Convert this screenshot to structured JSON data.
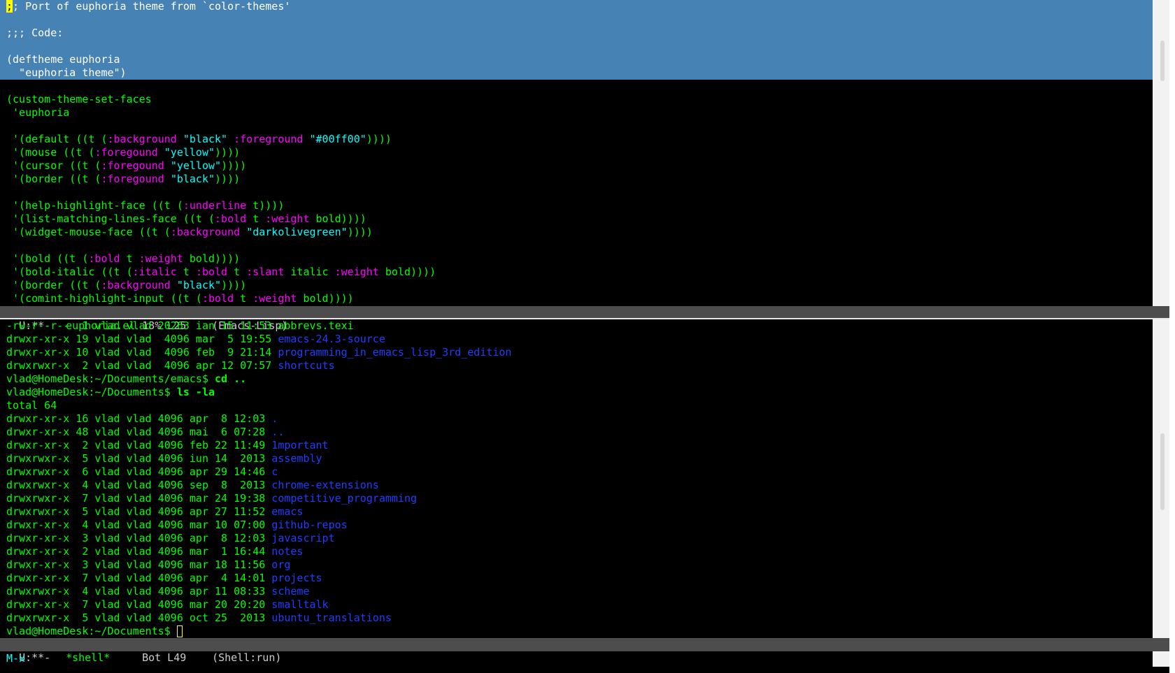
{
  "editor": {
    "lines": [
      {
        "hl": true,
        "segs": [
          {
            "t": ";",
            "c": "cursor-fill"
          },
          {
            "t": "; Port of euphoria theme from `color-themes'"
          }
        ]
      },
      {
        "hl": true,
        "segs": [
          {
            "t": ""
          }
        ]
      },
      {
        "hl": true,
        "segs": [
          {
            "t": ";;; Code:"
          }
        ]
      },
      {
        "hl": true,
        "segs": [
          {
            "t": ""
          }
        ]
      },
      {
        "hl": true,
        "segs": [
          {
            "t": "(deftheme euphoria"
          }
        ]
      },
      {
        "hl": true,
        "segs": [
          {
            "t": "  \"euphoria theme\")"
          }
        ]
      },
      {
        "segs": [
          {
            "t": ""
          }
        ]
      },
      {
        "segs": [
          {
            "t": "(custom-theme-set-faces"
          }
        ]
      },
      {
        "segs": [
          {
            "t": " 'euphoria"
          }
        ]
      },
      {
        "segs": [
          {
            "t": ""
          }
        ]
      },
      {
        "segs": [
          {
            "t": " '(default ((t ("
          },
          {
            "t": ":background",
            "c": "kw"
          },
          {
            "t": " "
          },
          {
            "t": "\"black\"",
            "c": "str"
          },
          {
            "t": " "
          },
          {
            "t": ":foreground",
            "c": "kw"
          },
          {
            "t": " "
          },
          {
            "t": "\"#00ff00\"",
            "c": "str"
          },
          {
            "t": "))))"
          }
        ]
      },
      {
        "segs": [
          {
            "t": " '(mouse ((t ("
          },
          {
            "t": ":foregound",
            "c": "kw"
          },
          {
            "t": " "
          },
          {
            "t": "\"yellow\"",
            "c": "str"
          },
          {
            "t": "))))"
          }
        ]
      },
      {
        "segs": [
          {
            "t": " '(cursor ((t ("
          },
          {
            "t": ":foregound",
            "c": "kw"
          },
          {
            "t": " "
          },
          {
            "t": "\"yellow\"",
            "c": "str"
          },
          {
            "t": "))))"
          }
        ]
      },
      {
        "segs": [
          {
            "t": " '(border ((t ("
          },
          {
            "t": ":foregound",
            "c": "kw"
          },
          {
            "t": " "
          },
          {
            "t": "\"black\"",
            "c": "str"
          },
          {
            "t": "))))"
          }
        ]
      },
      {
        "segs": [
          {
            "t": ""
          }
        ]
      },
      {
        "segs": [
          {
            "t": " '(help-highlight-face ((t ("
          },
          {
            "t": ":underline",
            "c": "kw"
          },
          {
            "t": " t))))"
          }
        ]
      },
      {
        "segs": [
          {
            "t": " '(list-matching-lines-face ((t ("
          },
          {
            "t": ":bold",
            "c": "kw"
          },
          {
            "t": " t "
          },
          {
            "t": ":weight",
            "c": "kw"
          },
          {
            "t": " bold))))"
          }
        ]
      },
      {
        "segs": [
          {
            "t": " '(widget-mouse-face ((t ("
          },
          {
            "t": ":background",
            "c": "kw"
          },
          {
            "t": " "
          },
          {
            "t": "\"darkolivegreen\"",
            "c": "str"
          },
          {
            "t": "))))"
          }
        ]
      },
      {
        "segs": [
          {
            "t": ""
          }
        ]
      },
      {
        "segs": [
          {
            "t": " '(bold ((t ("
          },
          {
            "t": ":bold",
            "c": "kw"
          },
          {
            "t": " t "
          },
          {
            "t": ":weight",
            "c": "kw"
          },
          {
            "t": " bold))))"
          }
        ]
      },
      {
        "segs": [
          {
            "t": " '(bold-italic ((t ("
          },
          {
            "t": ":italic",
            "c": "kw"
          },
          {
            "t": " t "
          },
          {
            "t": ":bold",
            "c": "kw"
          },
          {
            "t": " t "
          },
          {
            "t": ":slant",
            "c": "kw"
          },
          {
            "t": " italic "
          },
          {
            "t": ":weight",
            "c": "kw"
          },
          {
            "t": " bold))))"
          }
        ]
      },
      {
        "segs": [
          {
            "t": " '(border ((t ("
          },
          {
            "t": ":background",
            "c": "kw"
          },
          {
            "t": " "
          },
          {
            "t": "\"black\"",
            "c": "str"
          },
          {
            "t": "))))"
          }
        ]
      },
      {
        "segs": [
          {
            "t": " '(comint-highlight-input ((t ("
          },
          {
            "t": ":bold",
            "c": "kw"
          },
          {
            "t": " t "
          },
          {
            "t": ":weight",
            "c": "kw"
          },
          {
            "t": " bold))))"
          }
        ]
      }
    ]
  },
  "modeline_top": {
    "state": "U:**-",
    "buffer": "euphoria.el",
    "position": "18% L25",
    "mode": "(Emacs-Lisp)"
  },
  "shell": {
    "lines": [
      {
        "segs": [
          {
            "t": "-rw-r--r--  1 vlad vlad 20263 ian 15 11:53 abbrevs.texi"
          }
        ]
      },
      {
        "segs": [
          {
            "t": "drwxr-xr-x 19 vlad vlad  4096 mar  5 19:55 "
          },
          {
            "t": "emacs-24.3-source",
            "c": "dir"
          }
        ]
      },
      {
        "segs": [
          {
            "t": "drwxr-xr-x 10 vlad vlad  4096 feb  9 21:14 "
          },
          {
            "t": "programming_in_emacs_lisp_3rd_edition",
            "c": "dir"
          }
        ]
      },
      {
        "segs": [
          {
            "t": "drwxrwxr-x  2 vlad vlad  4096 apr 12 07:57 "
          },
          {
            "t": "shortcuts",
            "c": "dir"
          }
        ]
      },
      {
        "segs": [
          {
            "t": "vlad@HomeDesk:~/Documents/emacs$ "
          },
          {
            "t": "cd ..",
            "c": "cmd"
          }
        ]
      },
      {
        "segs": [
          {
            "t": "vlad@HomeDesk:~/Documents$ "
          },
          {
            "t": "ls -la",
            "c": "cmd"
          }
        ]
      },
      {
        "segs": [
          {
            "t": "total 64"
          }
        ]
      },
      {
        "segs": [
          {
            "t": "drwxr-xr-x 16 vlad vlad 4096 apr  8 12:03 "
          },
          {
            "t": ".",
            "c": "dir"
          }
        ]
      },
      {
        "segs": [
          {
            "t": "drwxr-xr-x 48 vlad vlad 4096 mai  6 07:28 "
          },
          {
            "t": "..",
            "c": "dir"
          }
        ]
      },
      {
        "segs": [
          {
            "t": "drwxr-xr-x  2 vlad vlad 4096 feb 22 11:49 "
          },
          {
            "t": "1mportant",
            "c": "dir"
          }
        ]
      },
      {
        "segs": [
          {
            "t": "drwxrwxr-x  5 vlad vlad 4096 iun 14  2013 "
          },
          {
            "t": "assembly",
            "c": "dir"
          }
        ]
      },
      {
        "segs": [
          {
            "t": "drwxrwxr-x  6 vlad vlad 4096 apr 29 14:46 "
          },
          {
            "t": "c",
            "c": "dir"
          }
        ]
      },
      {
        "segs": [
          {
            "t": "drwxrwxr-x  4 vlad vlad 4096 sep  8  2013 "
          },
          {
            "t": "chrome-extensions",
            "c": "dir"
          }
        ]
      },
      {
        "segs": [
          {
            "t": "drwxrwxr-x  7 vlad vlad 4096 mar 24 19:38 "
          },
          {
            "t": "competitive_programming",
            "c": "dir"
          }
        ]
      },
      {
        "segs": [
          {
            "t": "drwxrwxr-x  5 vlad vlad 4096 apr 27 11:52 "
          },
          {
            "t": "emacs",
            "c": "dir"
          }
        ]
      },
      {
        "segs": [
          {
            "t": "drwxr-xr-x  4 vlad vlad 4096 mar 10 07:00 "
          },
          {
            "t": "github-repos",
            "c": "dir"
          }
        ]
      },
      {
        "segs": [
          {
            "t": "drwxr-xr-x  3 vlad vlad 4096 apr  8 12:03 "
          },
          {
            "t": "javascript",
            "c": "dir"
          }
        ]
      },
      {
        "segs": [
          {
            "t": "drwxr-xr-x  2 vlad vlad 4096 mar  1 16:44 "
          },
          {
            "t": "notes",
            "c": "dir"
          }
        ]
      },
      {
        "segs": [
          {
            "t": "drwxr-xr-x  3 vlad vlad 4096 mar 18 11:56 "
          },
          {
            "t": "org",
            "c": "dir"
          }
        ]
      },
      {
        "segs": [
          {
            "t": "drwxr-xr-x  7 vlad vlad 4096 apr  4 14:01 "
          },
          {
            "t": "projects",
            "c": "dir"
          }
        ]
      },
      {
        "segs": [
          {
            "t": "drwxrwxr-x  4 vlad vlad 4096 apr 11 08:33 "
          },
          {
            "t": "scheme",
            "c": "dir"
          }
        ]
      },
      {
        "segs": [
          {
            "t": "drwxr-xr-x  7 vlad vlad 4096 mar 20 20:20 "
          },
          {
            "t": "smalltalk",
            "c": "dir"
          }
        ]
      },
      {
        "segs": [
          {
            "t": "drwxrwxr-x  5 vlad vlad 4096 oct 25  2013 "
          },
          {
            "t": "ubuntu_translations",
            "c": "dir"
          }
        ]
      },
      {
        "segs": [
          {
            "t": "vlad@HomeDesk:~/Documents$ "
          },
          {
            "t": "",
            "c": "cursor-box"
          }
        ]
      }
    ]
  },
  "modeline_bottom": {
    "state": "U:**-",
    "buffer": "*shell*",
    "position": "Bot L49",
    "mode": "(Shell:run)"
  },
  "minibuffer": {
    "text": "M-x"
  },
  "colors": {
    "background": "#000000",
    "foreground": "#00ff00",
    "region": "#4682b4",
    "keyword": "#ff00ff",
    "string": "#00ffff",
    "directory": "#1f3fff",
    "cursor": "#ffff00"
  }
}
